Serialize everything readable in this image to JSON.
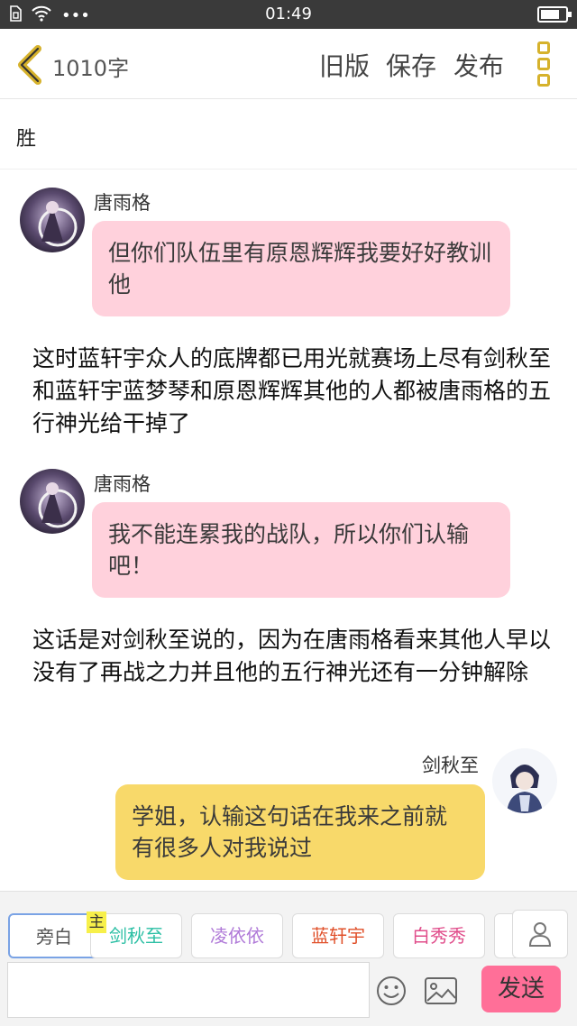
{
  "status_bar": {
    "time": "01:49",
    "dots": "•••"
  },
  "header": {
    "word_count": "1010字",
    "old_version": "旧版",
    "save": "保存",
    "publish": "发布"
  },
  "title": "胜",
  "messages": [
    {
      "type": "dialogue",
      "speaker": "唐雨格",
      "text": "但你们队伍里有原恩辉辉我要好好教训他",
      "side": "left"
    },
    {
      "type": "narration",
      "text": "这时蓝轩宇众人的底牌都已用光就赛场上尽有剑秋至和蓝轩宇蓝梦琴和原恩辉辉其他的人都被唐雨格的五行神光给干掉了"
    },
    {
      "type": "dialogue",
      "speaker": "唐雨格",
      "text": "我不能连累我的战队，所以你们认输吧！",
      "side": "left"
    },
    {
      "type": "narration",
      "text": "这话是对剑秋至说的，因为在唐雨格看来其他人早以没有了再战之力并且他的五行神光还有一分钟解除"
    },
    {
      "type": "dialogue",
      "speaker": "剑秋至",
      "text": "学姐，认输这句话在我来之前就有很多人对我说过",
      "side": "right"
    }
  ],
  "roles": {
    "badge": "主",
    "tabs": [
      {
        "label": "旁白",
        "color": "#555555"
      },
      {
        "label": "剑秋至",
        "color": "#2bbfa4"
      },
      {
        "label": "凌依依",
        "color": "#b07ad8"
      },
      {
        "label": "蓝轩宇",
        "color": "#e0502a"
      },
      {
        "label": "白秀秀",
        "color": "#e04c8a"
      }
    ]
  },
  "composer": {
    "input_value": "",
    "send_label": "发送"
  },
  "colors": {
    "accent_yellow": "#d6b22c",
    "send": "#ff6f98",
    "bubble_pink": "#ffd1dc",
    "bubble_yellow": "#f8d96a"
  }
}
